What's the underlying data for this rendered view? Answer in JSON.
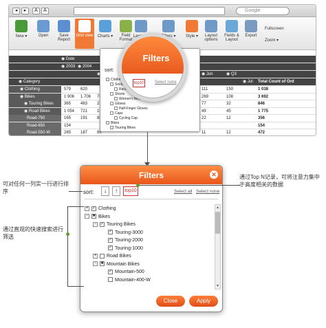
{
  "browser": {
    "nav_buttons": [
      "◂",
      "▸",
      "A",
      "A"
    ],
    "search_placeholder": "Google"
  },
  "toolbar": {
    "buttons": [
      {
        "label": "New ▾",
        "color": "#4a9a3a"
      },
      {
        "label": "Open",
        "color": "#6a9ad0"
      },
      {
        "label": "Save Report",
        "color": "#5b8fcf"
      },
      {
        "label": "Grid view",
        "color": "#f07a35"
      },
      {
        "label": "Charts ▾",
        "color": "#5a9fd8"
      },
      {
        "label": "Field Format",
        "color": "#8ab04a"
      },
      {
        "label": "Layout ▾",
        "color": "#6f9ac8"
      },
      {
        "label": "Filters ▾",
        "color": "#6f9ac8"
      },
      {
        "label": "Style ▾",
        "color": "#f07a35"
      },
      {
        "label": "Layout options",
        "color": "#6f9ac8"
      },
      {
        "label": "Fields & Layout",
        "color": "#6aa8d8"
      },
      {
        "label": "Export",
        "color": "#7a9ac0"
      }
    ],
    "fullscreen": "Fullscreen",
    "zoom": "Zoom ▾"
  },
  "grid": {
    "col_dates": [
      "◉ Date",
      "◉ 2003",
      "◉ 2004",
      "◉ Q1",
      "◉ Jun",
      "◉ Q3",
      "◉ Jul"
    ],
    "total_header": "Total Count of Ord",
    "category_header": "◉ Category",
    "rows": [
      {
        "label": "◉ Clothing",
        "v": [
          "579",
          "620",
          "",
          "",
          "111",
          "150",
          "1 038"
        ]
      },
      {
        "label": "◉ Bikes",
        "v": [
          "1 906",
          "1 706",
          "788",
          "",
          "269",
          "108",
          "3 692"
        ]
      },
      {
        "label": "◉ Touring Bikes",
        "v": [
          "365",
          "483",
          "220",
          "",
          "77",
          "32",
          "846"
        ]
      },
      {
        "label": "◉ Road Bikes",
        "v": [
          "1 054",
          "721",
          "199",
          "",
          "49",
          "45",
          "1 775"
        ]
      },
      {
        "label": "Road-750",
        "v": [
          "165",
          "191",
          "88",
          "",
          "22",
          "12",
          "356"
        ]
      },
      {
        "label": "Road-650",
        "v": [
          "154",
          "",
          "",
          "",
          "",
          "",
          "154"
        ]
      },
      {
        "label": "Road-550-W",
        "v": [
          "285",
          "187",
          "86",
          "",
          "11",
          "12",
          "472"
        ]
      }
    ]
  },
  "lens": {
    "title": "Filters",
    "sort_label": "sort:",
    "top10": "top10",
    "select_link": "Select none",
    "tree": [
      "Clothing",
      "Socks",
      "Racing Socks",
      "Shorts",
      "Women's Mountain Shorts",
      "Gloves",
      "Half-Finger Gloves",
      "Caps",
      "Cycling Cap",
      "Bikes",
      "Touring Bikes"
    ]
  },
  "dialog": {
    "title": "Filters",
    "close_icon": "✕",
    "sort_label": "sort:",
    "sort_asc": "↓",
    "sort_desc": "↑",
    "top10": "top10",
    "select_all": "Select all",
    "select_none": "Select none",
    "tree": [
      {
        "label": "Clothing",
        "level": 0,
        "exp": "+",
        "check": "✓"
      },
      {
        "label": "Bikes",
        "level": 0,
        "exp": "−",
        "check": "■"
      },
      {
        "label": "Touring Bikes",
        "level": 1,
        "exp": "−",
        "check": "✓"
      },
      {
        "label": "Touring-3000",
        "level": 2,
        "exp": "",
        "check": "✓"
      },
      {
        "label": "Touring-2000",
        "level": 2,
        "exp": "",
        "check": "✓"
      },
      {
        "label": "Touring-1000",
        "level": 2,
        "exp": "",
        "check": "✓"
      },
      {
        "label": "Road Bikes",
        "level": 1,
        "exp": "+",
        "check": ""
      },
      {
        "label": "Mountain Bikes",
        "level": 1,
        "exp": "−",
        "check": "■"
      },
      {
        "label": "Mountain-500",
        "level": 2,
        "exp": "",
        "check": "✓"
      },
      {
        "label": "Mountain-400-W",
        "level": 2,
        "exp": "",
        "check": ""
      }
    ],
    "close_label": "Close",
    "apply_label": "Apply"
  },
  "annotations": {
    "sort_note": "可对任何一列实一行进行排序",
    "search_note": "通过直观的快速搜索进行筛选",
    "top_note": "通过Top N记录，可将注意力集中于高度相关的数据"
  },
  "colors": {
    "accent": "#e8561b",
    "dark_row": "#5a5a5a"
  }
}
